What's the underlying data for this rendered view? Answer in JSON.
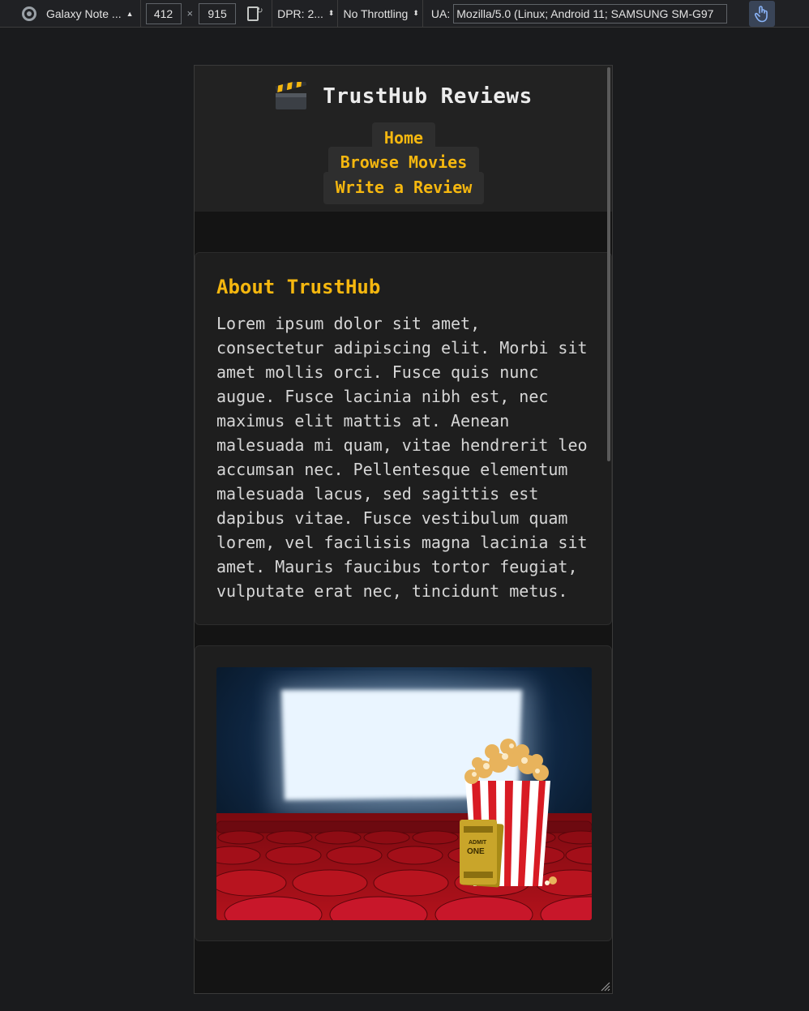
{
  "toolbar": {
    "device_name": "Galaxy Note ...",
    "width": "412",
    "times": "×",
    "height": "915",
    "dpr": "DPR: 2...",
    "throttling": "No Throttling",
    "ua_label": "UA:",
    "ua_value": "Mozilla/5.0 (Linux; Android 11; SAMSUNG SM-G97"
  },
  "site": {
    "title": "TrustHub Reviews",
    "logo_icon": "clapperboard-icon",
    "nav": [
      "Home",
      "Browse Movies",
      "Write a Review"
    ]
  },
  "about": {
    "heading": "About TrustHub",
    "body": "Lorem ipsum dolor sit amet,\nconsectetur adipiscing elit. Morbi sit\namet mollis orci. Fusce quis nunc\naugue. Fusce lacinia nibh est, nec\nmaximus elit mattis at. Aenean\nmalesuada mi quam, vitae hendrerit leo\naccumsan nec. Pellentesque elementum\nmalesuada lacus, sed sagittis est\ndapibus vitae. Fusce vestibulum quam\nlorem, vel facilisis magna lacinia sit\namet. Mauris faucibus tortor feugiat,\nvulputate erat nec, tincidunt metus."
  },
  "hero": {
    "ticket_line1": "ADMIT",
    "ticket_line2": "ONE"
  },
  "colors": {
    "accent": "#f5b70f",
    "header_bg": "#222222",
    "card_bg": "#1e1e1e",
    "page_bg": "#141414"
  }
}
